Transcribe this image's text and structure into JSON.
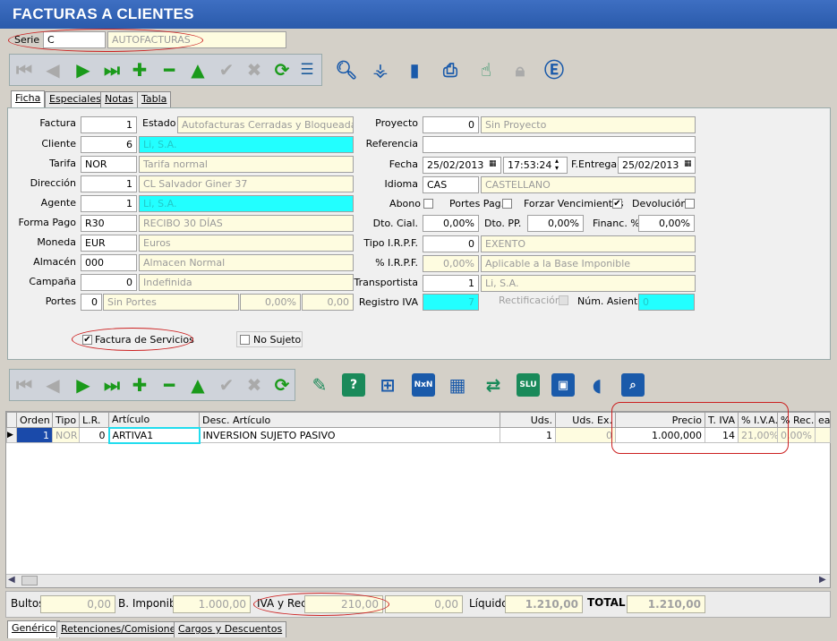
{
  "window": {
    "title": "FACTURAS A CLIENTES"
  },
  "serie": {
    "label": "Serie",
    "code": "C",
    "desc": "AUTOFACTURAS"
  },
  "tabs": [
    {
      "label": "Ficha"
    },
    {
      "label": "Especiales"
    },
    {
      "label": "Notas"
    },
    {
      "label": "Tabla"
    }
  ],
  "form": {
    "factura": {
      "label": "Factura",
      "value": "1"
    },
    "estado": {
      "label": "Estado",
      "value": "Autofacturas Cerradas y Bloqueadas"
    },
    "cliente": {
      "label": "Cliente",
      "value": "6",
      "desc": "Li, S.A."
    },
    "tarifa": {
      "label": "Tarifa",
      "code": "NOR",
      "desc": "Tarifa normal"
    },
    "direccion": {
      "label": "Dirección",
      "value": "1",
      "desc": " CL  Salvador Giner 37"
    },
    "agente": {
      "label": "Agente",
      "value": "1",
      "desc": "Li, S.A."
    },
    "forma_pago": {
      "label": "Forma Pago",
      "code": "R30",
      "desc": "RECIBO 30 DÍAS"
    },
    "moneda": {
      "label": "Moneda",
      "code": "EUR",
      "desc": "Euros"
    },
    "almacen": {
      "label": "Almacén",
      "code": "000",
      "desc": "Almacen Normal"
    },
    "campana": {
      "label": "Campaña",
      "value": "0",
      "desc": "Indefinida"
    },
    "portes": {
      "label": "Portes",
      "value": "0",
      "desc": "Sin Portes",
      "pct": "0,00%",
      "amount": "0,00"
    },
    "proyecto": {
      "label": "Proyecto",
      "value": "0",
      "desc": "Sin Proyecto"
    },
    "referencia": {
      "label": "Referencia",
      "value": ""
    },
    "fecha": {
      "label": "Fecha",
      "date": "25/02/2013",
      "time": "17:53:24"
    },
    "f_entrega": {
      "label": "F.Entrega",
      "date": "25/02/2013"
    },
    "idioma": {
      "label": "Idioma",
      "code": "CAS",
      "desc": "CASTELLANO"
    },
    "abono": {
      "label": "Abono"
    },
    "portes_pag": {
      "label": "Portes Pag."
    },
    "forzar_venc": {
      "label": "Forzar Vencimientos"
    },
    "devolucion": {
      "label": "Devolución"
    },
    "dto_cial": {
      "label": "Dto. Cial.",
      "value": "0,00%"
    },
    "dto_pp": {
      "label": "Dto. PP.",
      "value": "0,00%"
    },
    "financ": {
      "label": "Financ. %",
      "value": "0,00%"
    },
    "tipo_irpf": {
      "label": "Tipo I.R.P.F.",
      "value": "0",
      "desc": "EXENTO"
    },
    "pct_irpf": {
      "label": "% I.R.P.F.",
      "value": "0,00%",
      "desc": "Aplicable a la Base Imponible"
    },
    "transportista": {
      "label": "Transportista",
      "value": "1",
      "desc": "Li, S.A."
    },
    "registro_iva": {
      "label": "Registro IVA",
      "value": "7"
    },
    "rectificacion": {
      "label": "Rectificación"
    },
    "num_asiento": {
      "label": "Núm. Asiento",
      "value": "0"
    },
    "factura_servicios": {
      "label": "Factura de Servicios",
      "checked": "✔"
    },
    "no_sujeto": {
      "label": "No Sujeto"
    }
  },
  "grid": {
    "headers": [
      "Orden",
      "Tipo",
      "L.R.",
      "Artículo",
      "Desc. Artículo",
      "Uds.",
      "Uds. Ex.",
      "Precio",
      "T. IVA",
      "% I.V.A.",
      "% Rec.",
      "ea"
    ],
    "rows": [
      [
        "1",
        "NOR",
        "0",
        "ARTIVA1",
        "INVERSION SUJETO PASIVO",
        "1",
        "0",
        "1.000,000",
        "14",
        "21,00%",
        "0,00%",
        ""
      ]
    ]
  },
  "totals": {
    "bultos": {
      "label": "Bultos",
      "value": "0,00"
    },
    "base": {
      "label": "B. Imponible",
      "value": "1.000,00"
    },
    "iva": {
      "label": "IVA y Rec.",
      "value": "210,00",
      "rec": "0,00"
    },
    "liquido": {
      "label": "Líquido",
      "value": "1.210,00"
    },
    "total": {
      "label": "TOTAL",
      "value": "1.210,00"
    }
  },
  "bottom_tabs": [
    {
      "label": "Genérico"
    },
    {
      "label": "Retenciones/Comisiones"
    },
    {
      "label": "Cargos y Descuentos"
    }
  ],
  "colors": {
    "title": "#2a5aab",
    "highlight": "#cc2020",
    "cyan": "#22ffff",
    "readonly": "#fefce0"
  }
}
